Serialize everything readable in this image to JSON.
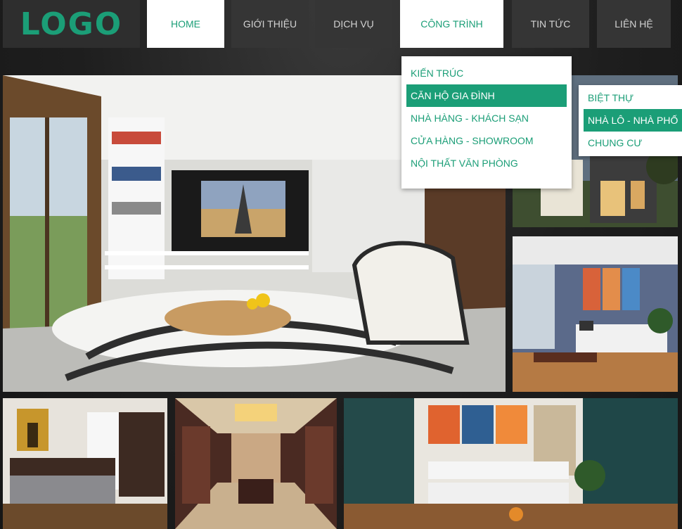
{
  "theme": {
    "accent": "#1b9e77",
    "nav_bg": "#353535",
    "nav_text": "#d2d2d2"
  },
  "header": {
    "logo": "LOGO"
  },
  "nav": {
    "items": [
      {
        "label": "HOME",
        "active": true
      },
      {
        "label": "GIỚI THIỆU",
        "active": false
      },
      {
        "label": "DỊCH VỤ",
        "active": false
      },
      {
        "label": "CÔNG TRÌNH",
        "active": true
      },
      {
        "label": "TIN TỨC",
        "active": false
      },
      {
        "label": "LIÊN HỆ",
        "active": false
      }
    ]
  },
  "submenu": {
    "items": [
      {
        "label": "KIẾN TRÚC",
        "active": false
      },
      {
        "label": "CĂN HỘ GIA ĐÌNH",
        "active": true
      },
      {
        "label": "NHÀ HÀNG - KHÁCH SẠN",
        "active": false
      },
      {
        "label": "CỬA HÀNG - SHOWROOM",
        "active": false
      },
      {
        "label": "NỘI THẤT VĂN PHÒNG",
        "active": false
      }
    ]
  },
  "subsubmenu": {
    "items": [
      {
        "label": "BIỆT THỰ",
        "active": false
      },
      {
        "label": "NHÀ LÔ - NHÀ PHỐ",
        "active": true
      },
      {
        "label": "CHUNG CƯ",
        "active": false
      }
    ]
  },
  "gallery": [
    {
      "name": "living-room-large",
      "icon": "living-room-photo"
    },
    {
      "name": "house-exterior",
      "icon": "house-photo"
    },
    {
      "name": "lounge-blue-wall",
      "icon": "lounge-photo"
    },
    {
      "name": "bedroom",
      "icon": "bedroom-photo"
    },
    {
      "name": "wood-hallway",
      "icon": "hallway-photo"
    },
    {
      "name": "teal-living-room",
      "icon": "living-room-photo"
    }
  ]
}
